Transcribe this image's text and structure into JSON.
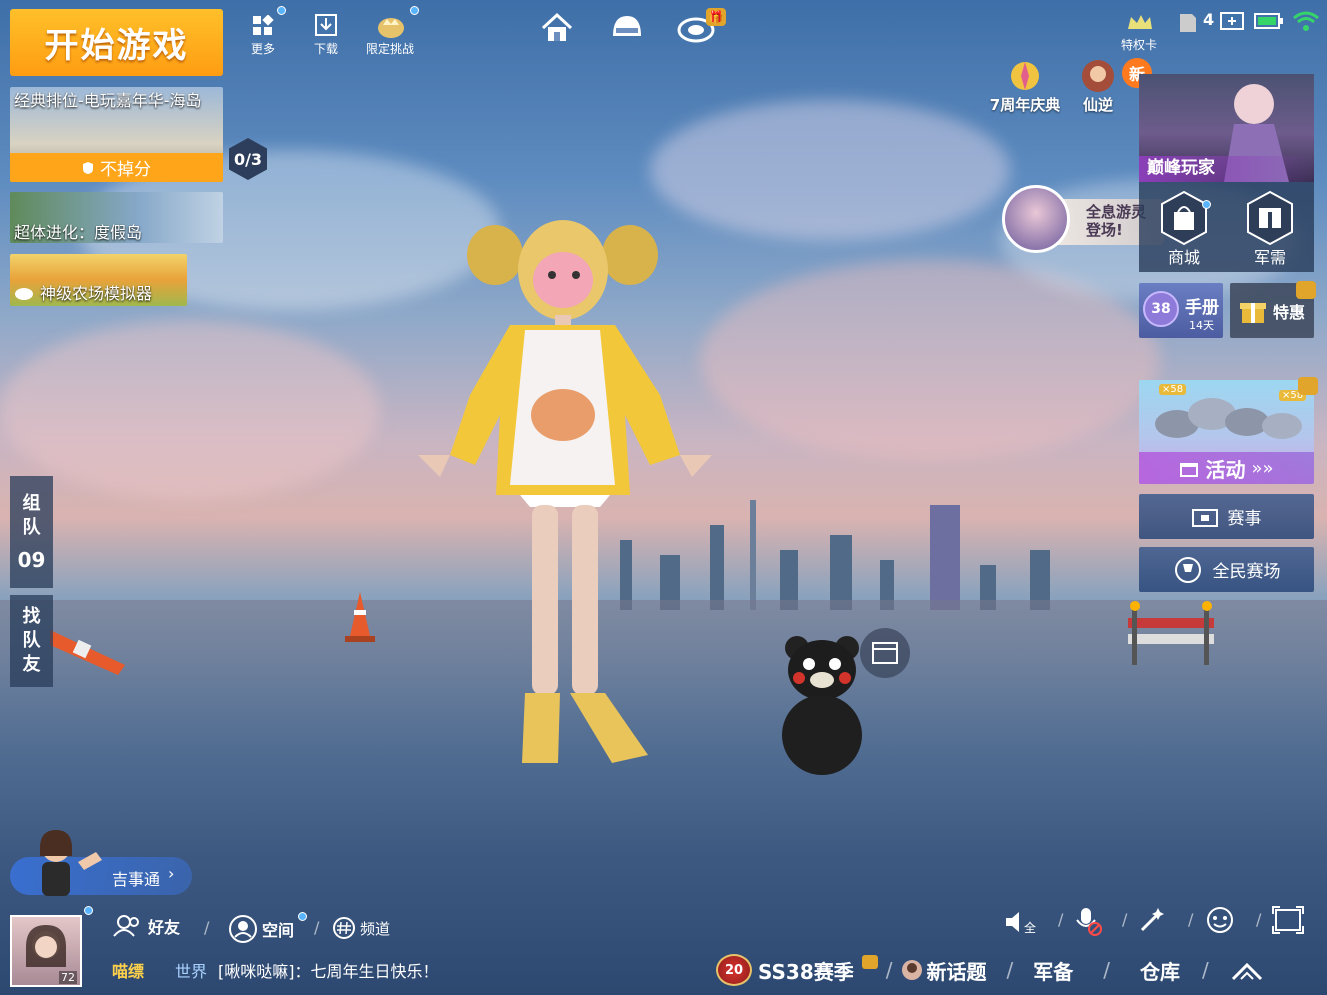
{
  "top_left": {
    "start_game": "开始游戏",
    "more": "更多",
    "download": "下载",
    "limited_challenge": "限定挑战"
  },
  "modes": {
    "classic": "经典排位-电玩嘉年华-海岛",
    "no_loss": "不掉分",
    "evolution": "超体进化：度假岛",
    "farm": "神级农场模拟器",
    "quest_count": "0/3"
  },
  "status_bar": {
    "privilege_card": "特权卡",
    "signal_count": "4"
  },
  "right_panel": {
    "anniversary": "7周年庆典",
    "xianni": "仙逆",
    "new_badge": "新",
    "peak_player": "巅峰玩家",
    "hologram_promo": "全息游灵登场!",
    "shop": "商城",
    "supplies": "军需",
    "handbook": "手册",
    "handbook_days": "14天",
    "special_offer": "特惠",
    "activity": "活动",
    "activity_arrows": "»»",
    "coin_x58_left": "×58",
    "coin_x58_right": "×58",
    "events": "赛事",
    "arena": "全民赛场"
  },
  "left_tabs": {
    "team_chars": [
      "组",
      "队"
    ],
    "team_count": "09",
    "find_chars": [
      "找",
      "队",
      "友"
    ]
  },
  "bottom": {
    "helper": "吉事通",
    "friends": "好友",
    "space": "空间",
    "channel": "频道",
    "player_name": "喵缥",
    "player_level": "72",
    "chat_channel": "世界",
    "chat_message": "[啾咪哒嘛]：七周年生日快乐！",
    "season_level": "20",
    "season": "SS38赛季",
    "new_topic": "新话题",
    "equipment": "军备",
    "warehouse": "仓库",
    "voice_all": "全"
  },
  "colors": {
    "start_orange": "#ffa51a",
    "accent_blue": "#58b4ff",
    "gold": "#ffd24a"
  }
}
